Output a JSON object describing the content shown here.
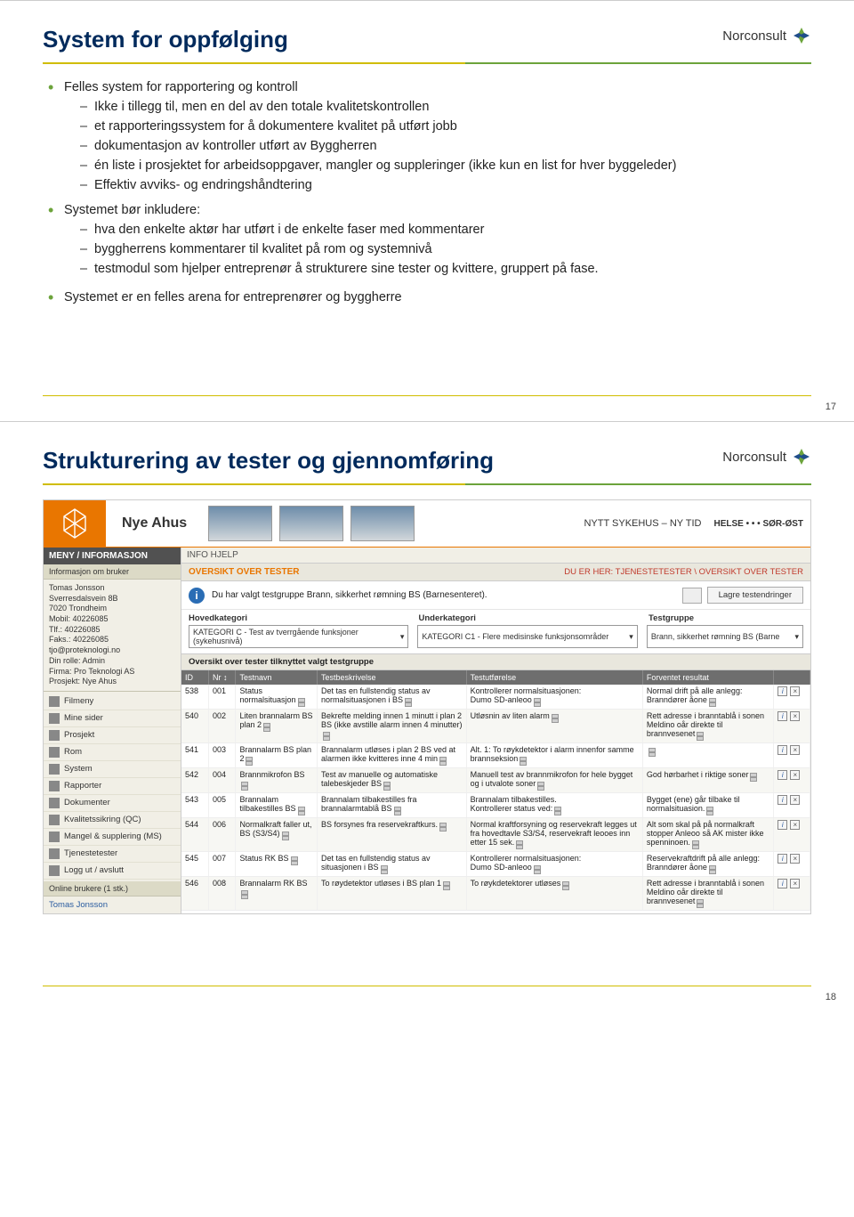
{
  "logo_text": "Norconsult",
  "slide1": {
    "title": "System for oppfølging",
    "b1": "Felles system for rapportering og kontroll",
    "b1_sub": [
      "Ikke i tillegg til, men en del av den totale kvalitetskontrollen",
      "et rapporteringssystem for å dokumentere kvalitet på utført jobb",
      "dokumentasjon av kontroller utført av Byggherren",
      "én liste i prosjektet for arbeidsoppgaver, mangler og suppleringer (ikke kun en list for hver byggeleder)",
      "Effektiv avviks- og endringshåndtering"
    ],
    "b2": "Systemet bør inkludere:",
    "b2_sub": [
      "hva den enkelte aktør har utført i de enkelte faser med kommentarer",
      "byggherrens kommentarer til kvalitet på rom og systemnivå",
      "testmodul som hjelper entreprenør å strukturere sine tester og kvittere, gruppert på fase."
    ],
    "b3": "Systemet er en felles arena for entreprenører og byggherre",
    "page": "17"
  },
  "slide2": {
    "title": "Strukturering av tester og gjennomføring",
    "page": "18",
    "app": {
      "name": "Nye Ahus",
      "motto": "NYTT SYKEHUS – NY TID",
      "helse": "HELSE • • • SØR-ØST",
      "tabs": "INFO   HJELP",
      "menu_head": "MENY / INFORMASJON",
      "info_bruker": "Informasjon om bruker",
      "user_block": "Tomas Jonsson\nSverresdalsvein 8B\n7020 Trondheim\nMobil: 40226085\nTlf.: 40226085\nFaks.: 40226085\ntjo@proteknologi.no\nDin rolle: Admin\nFirma: Pro Teknologi AS\nProsjekt: Nye Ahus",
      "nav": [
        "Filmeny",
        "Mine sider",
        "Prosjekt",
        "Rom",
        "System",
        "Rapporter",
        "Dokumenter",
        "Kvalitetssikring (QC)",
        "Mangel & supplering (MS)",
        "Tjenestetester",
        "Logg ut / avslutt"
      ],
      "online_head": "Online brukere (1 stk.)",
      "online_user": "Tomas Jonsson",
      "section_left": "OVERSIKT OVER TESTER",
      "section_right": "DU ER HER: TJENESTETESTER \\ OVERSIKT OVER TESTER",
      "info_text": "Du har valgt testgruppe Brann, sikkerhet rømning BS (Barnesenteret).",
      "btn_save": "Lagre testendringer",
      "cat_labels": [
        "Hovedkategori",
        "Underkategori",
        "Testgruppe"
      ],
      "cat_vals": [
        "KATEGORI C - Test av tverrgående funksjoner (sykehusnivå)",
        "KATEGORI C1 - Flere medisinske funksjonsområder",
        "Brann, sikkerhet rømning BS (Barne"
      ],
      "sub_head": "Oversikt over tester tilknyttet valgt testgruppe",
      "cols": [
        "ID",
        "Nr",
        "Testnavn",
        "Testbeskrivelse",
        "Testutførelse",
        "Forventet resultat",
        ""
      ],
      "rows": [
        {
          "id": "538",
          "nr": "001",
          "name": "Status normalsituasjon",
          "desc": "Det tas en fullstendig status av normalsituasjonen i BS",
          "exec": "Kontrollerer normalsituasjonen:\nDumo SD-anleoo",
          "res": "Normal drift på alle anlegg:\nBranndører åone"
        },
        {
          "id": "540",
          "nr": "002",
          "name": "Liten brannalarm BS plan 2",
          "desc": "Bekrefte melding innen 1 minutt i plan 2 BS (ikke avstille alarm innen 4 minutter)",
          "exec": "Utløsnin av liten alarm",
          "res": "Rett adresse i branntablå i sonen\nMeldino oår direkte til brannvesenet"
        },
        {
          "id": "541",
          "nr": "003",
          "name": "Brannalarm BS plan 2",
          "desc": "Brannalarm utløses i plan 2 BS ved at alarmen ikke kvitteres inne 4 min",
          "exec": "Alt. 1: To røykdetektor i alarm innenfor samme brannseksion",
          "res": ""
        },
        {
          "id": "542",
          "nr": "004",
          "name": "Brannmikrofon BS",
          "desc": "Test av manuelle og automatiske talebeskjeder BS",
          "exec": "Manuell test av brannmikrofon for hele bygget og i utvalote soner",
          "res": "God hørbarhet i riktige soner"
        },
        {
          "id": "543",
          "nr": "005",
          "name": "Brannalam tilbakestilles BS",
          "desc": "Brannalam tilbakestilles fra brannalarmtablå BS",
          "exec": "Brannalam tilbakestilles.\nKontrollerer status ved:",
          "res": "Bygget (ene) går tilbake til normalsituasion."
        },
        {
          "id": "544",
          "nr": "006",
          "name": "Normalkraft faller ut, BS (S3/S4)",
          "desc": "BS forsynes fra reservekraftkurs.",
          "exec": "Normal kraftforsyning og reservekraft legges ut fra hovedtavle S3/S4, reservekraft leooes inn etter 15 sek.",
          "res": "Alt som skal på på normalkraft stopper Anleoo så AK mister ikke spenninoen."
        },
        {
          "id": "545",
          "nr": "007",
          "name": "Status RK BS",
          "desc": "Det tas en fullstendig status av situasjonen i BS",
          "exec": "Kontrollerer normalsituasjonen:\nDumo SD-anleoo",
          "res": "Reservekraftdrift på alle anlegg:\nBranndører åone"
        },
        {
          "id": "546",
          "nr": "008",
          "name": "Brannalarm RK BS",
          "desc": "To røydetektor utløses i BS plan 1",
          "exec": "To røykdetektorer utløses",
          "res": "Rett adresse i branntablå i sonen\nMeldino oår direkte til brannvesenet"
        }
      ]
    }
  }
}
